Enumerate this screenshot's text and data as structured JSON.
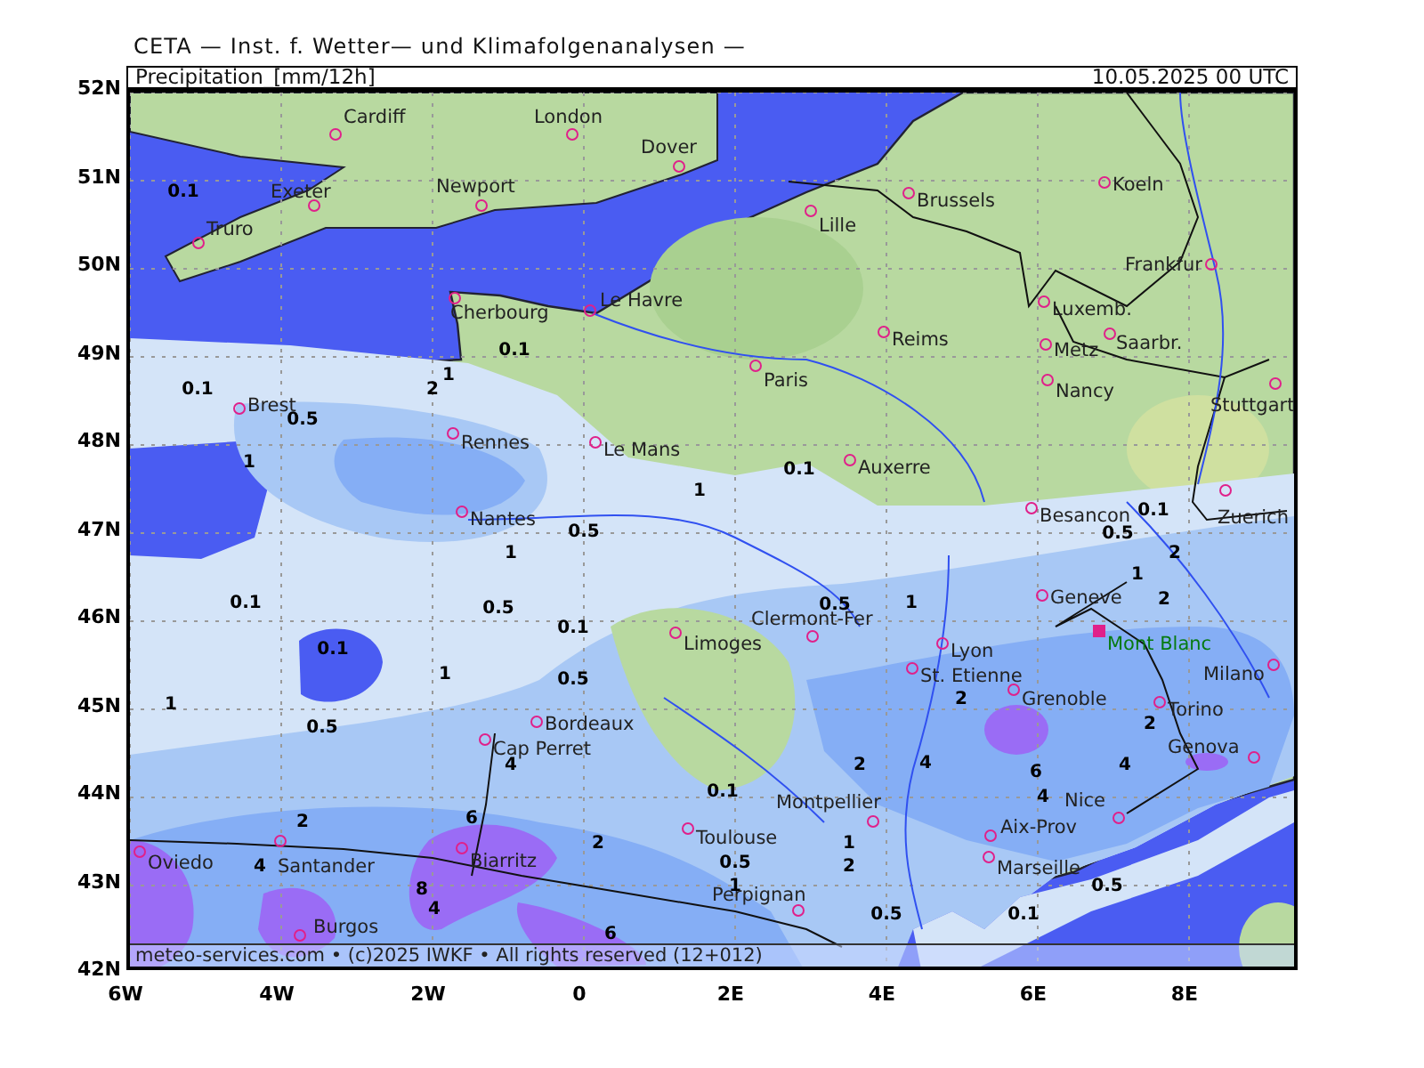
{
  "header": {
    "institute": "CETA — Inst. f. Wetter— und Klimafolgenanalysen —",
    "variable": "Precipitation_[mm/12h]",
    "valid_time": "10.05.2025 00 UTC"
  },
  "map": {
    "latitude_labels": [
      "52N",
      "51N",
      "50N",
      "49N",
      "48N",
      "47N",
      "46N",
      "45N",
      "44N",
      "43N",
      "42N"
    ],
    "longitude_labels": [
      "6W",
      "4W",
      "2W",
      "0",
      "2E",
      "4E",
      "6E",
      "8E"
    ],
    "cities": [
      {
        "name": "Cardiff",
        "kind": "city"
      },
      {
        "name": "London",
        "kind": "city"
      },
      {
        "name": "Dover",
        "kind": "city"
      },
      {
        "name": "Exeter",
        "kind": "city"
      },
      {
        "name": "Newport",
        "kind": "city"
      },
      {
        "name": "Brussels",
        "kind": "city"
      },
      {
        "name": "Koeln",
        "kind": "city"
      },
      {
        "name": "Truro",
        "kind": "city"
      },
      {
        "name": "Lille",
        "kind": "city"
      },
      {
        "name": "Frankfur",
        "kind": "city"
      },
      {
        "name": "Cherbourg",
        "kind": "city"
      },
      {
        "name": "Le Havre",
        "kind": "city"
      },
      {
        "name": "Luxemb.",
        "kind": "city"
      },
      {
        "name": "Reims",
        "kind": "city"
      },
      {
        "name": "Metz",
        "kind": "city"
      },
      {
        "name": "Saarbr.",
        "kind": "city"
      },
      {
        "name": "Paris",
        "kind": "city"
      },
      {
        "name": "Brest",
        "kind": "city"
      },
      {
        "name": "Nancy",
        "kind": "city"
      },
      {
        "name": "Stuttgart",
        "kind": "city"
      },
      {
        "name": "Rennes",
        "kind": "city"
      },
      {
        "name": "Le Mans",
        "kind": "city"
      },
      {
        "name": "Auxerre",
        "kind": "city"
      },
      {
        "name": "Nantes",
        "kind": "city"
      },
      {
        "name": "Besancon",
        "kind": "city"
      },
      {
        "name": "Zuerich",
        "kind": "city"
      },
      {
        "name": "Geneve",
        "kind": "city"
      },
      {
        "name": "Clermont-Fer",
        "kind": "city"
      },
      {
        "name": "Limoges",
        "kind": "city"
      },
      {
        "name": "Lyon",
        "kind": "city"
      },
      {
        "name": "Mont Blanc",
        "kind": "peak"
      },
      {
        "name": "St. Etienne",
        "kind": "city"
      },
      {
        "name": "Milano",
        "kind": "city"
      },
      {
        "name": "Grenoble",
        "kind": "city"
      },
      {
        "name": "Bordeaux",
        "kind": "city"
      },
      {
        "name": "Torino",
        "kind": "city"
      },
      {
        "name": "Cap Perret",
        "kind": "city"
      },
      {
        "name": "Genova",
        "kind": "city"
      },
      {
        "name": "Montpellier",
        "kind": "city"
      },
      {
        "name": "Nice",
        "kind": "city"
      },
      {
        "name": "Toulouse",
        "kind": "city"
      },
      {
        "name": "Aix-Prov",
        "kind": "city"
      },
      {
        "name": "Oviedo",
        "kind": "city"
      },
      {
        "name": "Santander",
        "kind": "city"
      },
      {
        "name": "Biarritz",
        "kind": "city"
      },
      {
        "name": "Marseille",
        "kind": "city"
      },
      {
        "name": "Perpignan",
        "kind": "city"
      },
      {
        "name": "Burgos",
        "kind": "city"
      }
    ],
    "contour_labels": [
      "0.1",
      "0.1",
      "0.1",
      "2",
      "1",
      "0.5",
      "1",
      "0.1",
      "1",
      "0.1",
      "0.5",
      "0.5",
      "1",
      "2",
      "1",
      "0.1",
      "0.5",
      "0.5",
      "1",
      "2",
      "0.1",
      "0.1",
      "1",
      "0.5",
      "1",
      "2",
      "0.5",
      "2",
      "4",
      "2",
      "4",
      "6",
      "4",
      "0.1",
      "4",
      "2",
      "6",
      "2",
      "1",
      "4",
      "0.5",
      "2",
      "8",
      "1",
      "0.5",
      "4",
      "0.5",
      "0.1",
      "6"
    ],
    "footer": "meteo-services.com • (c)2025 IWKF • All rights reserved (12+012)"
  }
}
